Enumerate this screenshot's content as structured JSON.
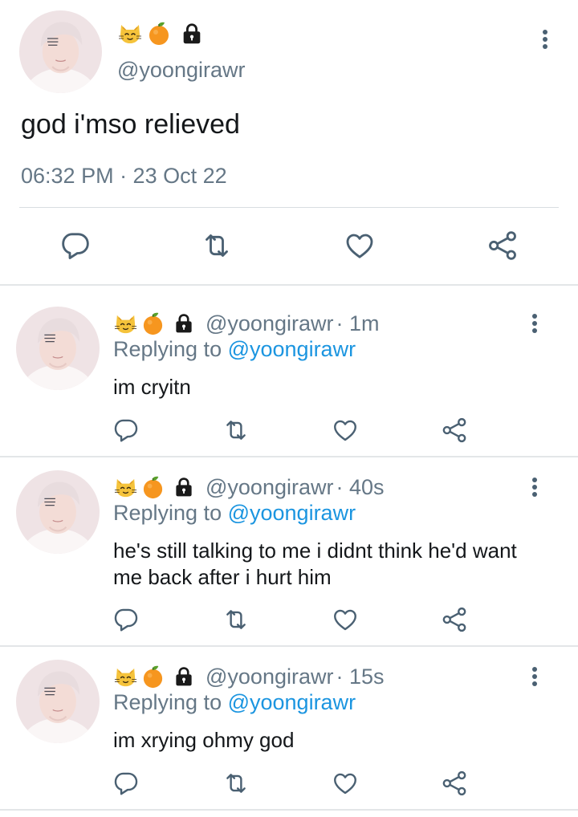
{
  "main_tweet": {
    "handle": "@yoongirawr",
    "emojis": [
      "cat-face-emoji",
      "tangerine-emoji",
      "lock-emoji"
    ],
    "text": "god i'mso relieved",
    "timestamp": "06:32 PM · 23 Oct 22"
  },
  "replies": [
    {
      "handle": "@yoongirawr",
      "time": " · 1m",
      "replying_prefix": "Replying to ",
      "replying_to": "@yoongirawr",
      "text": "im cryitn"
    },
    {
      "handle": "@yoongirawr",
      "time": " · 40s",
      "replying_prefix": "Replying to ",
      "replying_to": "@yoongirawr",
      "text": "he's still talking to me i didnt think he'd want me back after i hurt him"
    },
    {
      "handle": "@yoongirawr",
      "time": " · 15s",
      "replying_prefix": "Replying to ",
      "replying_to": "@yoongirawr",
      "text": "im xrying ohmy god"
    }
  ],
  "colors": {
    "text": "#14171a",
    "muted": "#657786",
    "link": "#1b95e0",
    "icon": "#4a6072",
    "divider": "#e3e6e8"
  }
}
